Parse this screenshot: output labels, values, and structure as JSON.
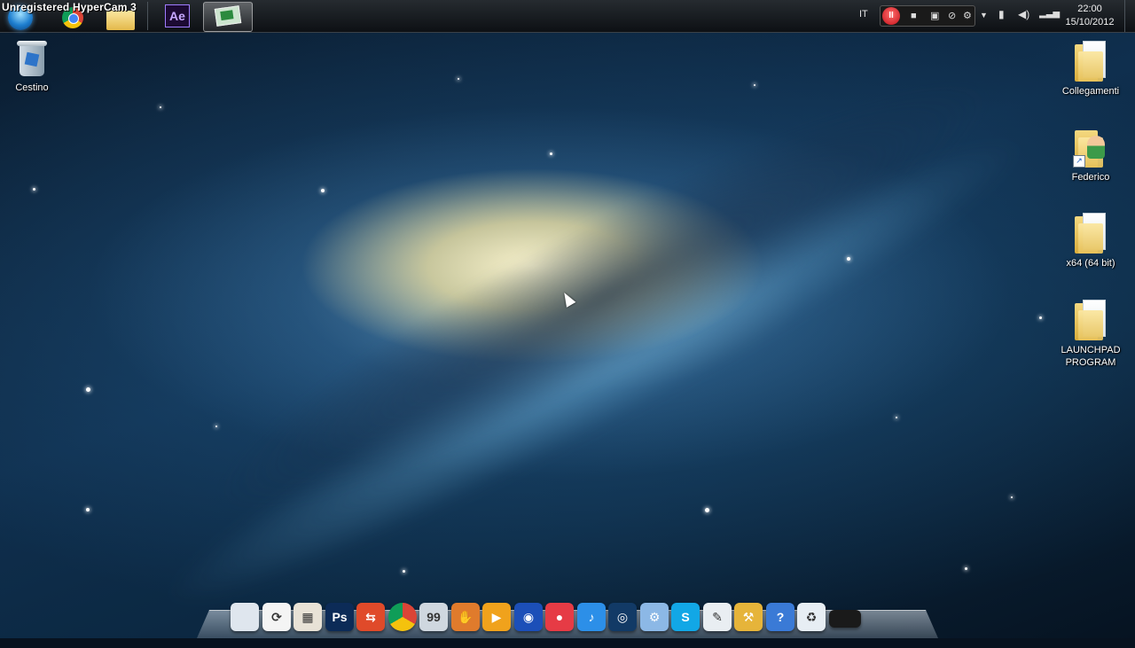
{
  "screen": {
    "watermark": "Unregistered HyperCam 3",
    "accent": "#1e7fd0"
  },
  "taskbar": {
    "pinned": [
      {
        "name": "start-orb",
        "icon": "windows-orb-icon"
      },
      {
        "name": "chrome",
        "icon": "chrome-icon"
      },
      {
        "name": "explorer",
        "icon": "folder-icon"
      },
      {
        "name": "after-effects",
        "icon": "after-effects-icon",
        "label": "Ae"
      },
      {
        "name": "hypercam",
        "icon": "screen-recorder-icon",
        "active": true
      }
    ]
  },
  "tray": {
    "language": "IT",
    "recorder": {
      "record_glyph": "II",
      "buttons": [
        "pause-record-icon",
        "stop-icon",
        "camera-icon",
        "mute-mic-icon",
        "settings-icon"
      ]
    },
    "icons": [
      "overflow-chevron-icon",
      "battery-icon",
      "volume-icon",
      "network-signal-icon"
    ],
    "clock": {
      "time": "22:00",
      "date": "15/10/2012"
    }
  },
  "desktop": {
    "icons": [
      {
        "name": "recycle-bin",
        "label": "Cestino",
        "icon": "recycle-bin-icon"
      },
      {
        "name": "collegamenti",
        "label": "Collegamenti",
        "icon": "folder-icon"
      },
      {
        "name": "federico",
        "label": "Federico",
        "icon": "user-folder-shortcut-icon"
      },
      {
        "name": "x64",
        "label": "x64 (64 bit)",
        "icon": "folder-icon"
      },
      {
        "name": "launchpad-program",
        "label": "LAUNCHPAD PROGRAM",
        "icon": "folder-icon"
      }
    ]
  },
  "dock": {
    "items": [
      {
        "name": "finder",
        "icon": "finder-icon",
        "color": "#dfe6ee",
        "glyph": ""
      },
      {
        "name": "sync",
        "icon": "sync-icon",
        "color": "#f4f4f4",
        "glyph": "⟳"
      },
      {
        "name": "image-viewer",
        "icon": "photo-icon",
        "color": "#e8e2d6",
        "glyph": "▦"
      },
      {
        "name": "photoshop",
        "icon": "photoshop-icon",
        "color": "#0c2b57",
        "glyph": "Ps"
      },
      {
        "name": "software-updater",
        "icon": "updater-icon",
        "color": "#e04a2a",
        "glyph": "⇆"
      },
      {
        "name": "chrome",
        "icon": "chrome-icon",
        "color": "#f2f2f2",
        "glyph": ""
      },
      {
        "name": "desktop-manager",
        "icon": "monitor-icon",
        "color": "#cfd7df",
        "glyph": "99"
      },
      {
        "name": "baseball-game",
        "icon": "baseball-glove-icon",
        "color": "#e07b2c",
        "glyph": "✋"
      },
      {
        "name": "media-player",
        "icon": "media-player-icon",
        "color": "#f0a21c",
        "glyph": "▶"
      },
      {
        "name": "globe-browser",
        "icon": "globe-icon",
        "color": "#1c4fb8",
        "glyph": "◉"
      },
      {
        "name": "record-app",
        "icon": "record-circle-icon",
        "color": "#e63b45",
        "glyph": "●"
      },
      {
        "name": "itunes",
        "icon": "music-note-icon",
        "color": "#2c8fe8",
        "glyph": "♪"
      },
      {
        "name": "dvd-player",
        "icon": "disc-icon",
        "color": "#123a66",
        "glyph": "◎"
      },
      {
        "name": "system-preferences",
        "icon": "gears-icon",
        "color": "#8cb8e6",
        "glyph": "⚙"
      },
      {
        "name": "skype",
        "icon": "skype-icon",
        "color": "#12a7e6",
        "glyph": "S"
      },
      {
        "name": "preview",
        "icon": "preview-icon",
        "color": "#e9eef2",
        "glyph": "✎"
      },
      {
        "name": "utilities",
        "icon": "tools-icon",
        "color": "#e6b43a",
        "glyph": "⚒"
      },
      {
        "name": "help",
        "icon": "help-icon",
        "color": "#3a7ad6",
        "glyph": "?"
      },
      {
        "name": "trash",
        "icon": "trash-icon",
        "color": "#e7eef4",
        "glyph": "♻"
      },
      {
        "name": "show-desktop",
        "icon": "desktop-icon",
        "color": "#1a1a1a",
        "glyph": ""
      }
    ]
  }
}
